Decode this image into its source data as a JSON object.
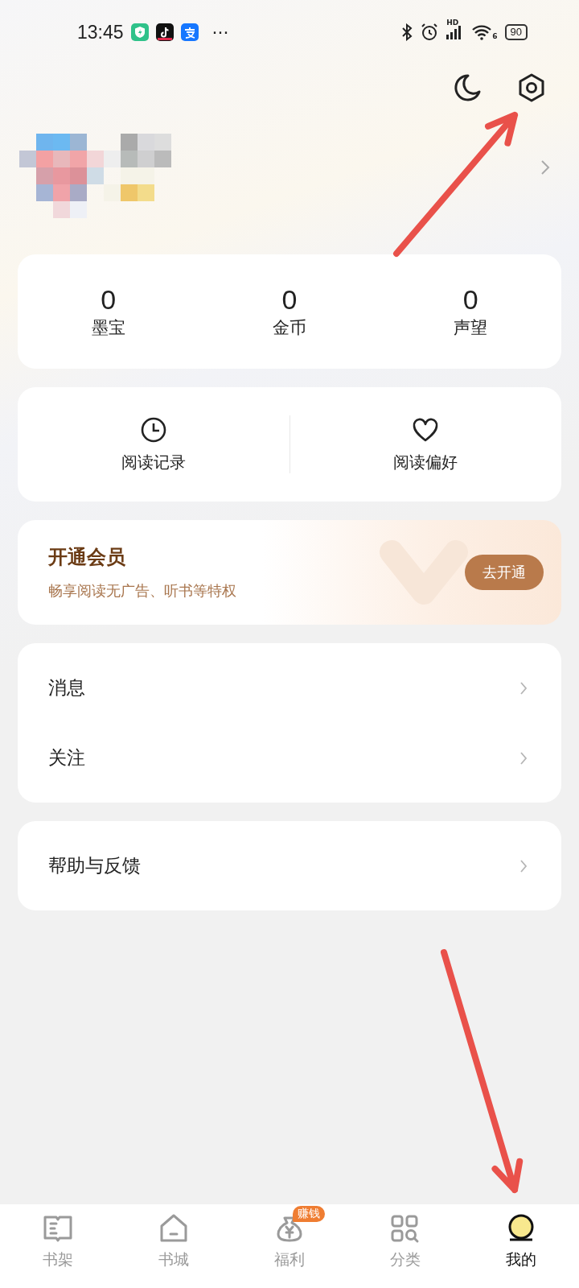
{
  "status_bar": {
    "time": "13:45",
    "more": "···",
    "network": "HD",
    "wifi": "6",
    "battery": "90"
  },
  "header": {
    "avatar": {
      "kind": "picture"
    }
  },
  "stats": [
    {
      "value": "0",
      "label": "墨宝"
    },
    {
      "value": "0",
      "label": "金币"
    },
    {
      "value": "0",
      "label": "声望"
    }
  ],
  "shortcuts": [
    {
      "kind": "clock",
      "label": "阅读记录"
    },
    {
      "kind": "heart",
      "label": "阅读偏好"
    }
  ],
  "vip": {
    "title": "开通会员",
    "subtitle": "畅享阅读无广告、听书等特权",
    "button": "去开通"
  },
  "menu_groups": [
    [
      {
        "label": "消息"
      },
      {
        "label": "关注"
      }
    ],
    [
      {
        "label": "帮助与反馈"
      }
    ]
  ],
  "tabs": [
    {
      "kind": "shelf",
      "label": "书架",
      "selected": false
    },
    {
      "kind": "store",
      "label": "书城",
      "selected": false
    },
    {
      "kind": "bag",
      "label": "福利",
      "selected": false,
      "badge": "赚钱"
    },
    {
      "kind": "grid",
      "label": "分类",
      "selected": false
    },
    {
      "kind": "avatar",
      "label": "我的",
      "selected": true
    }
  ],
  "annotations": [
    {
      "kind": "arrow"
    },
    {
      "kind": "arrow"
    }
  ]
}
